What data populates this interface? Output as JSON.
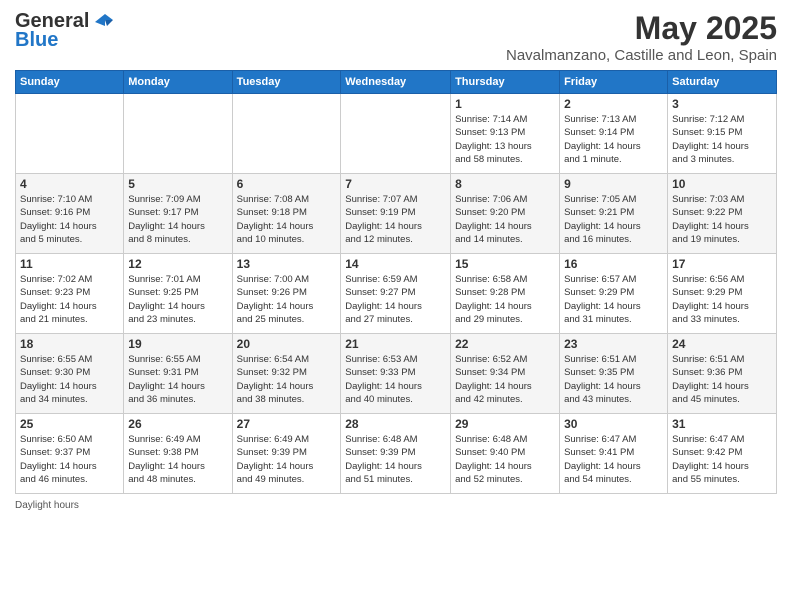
{
  "logo": {
    "general": "General",
    "blue": "Blue"
  },
  "header": {
    "title": "May 2025",
    "subtitle": "Navalmanzano, Castille and Leon, Spain"
  },
  "weekdays": [
    "Sunday",
    "Monday",
    "Tuesday",
    "Wednesday",
    "Thursday",
    "Friday",
    "Saturday"
  ],
  "weeks": [
    [
      {
        "day": "",
        "info": ""
      },
      {
        "day": "",
        "info": ""
      },
      {
        "day": "",
        "info": ""
      },
      {
        "day": "",
        "info": ""
      },
      {
        "day": "1",
        "info": "Sunrise: 7:14 AM\nSunset: 9:13 PM\nDaylight: 13 hours\nand 58 minutes."
      },
      {
        "day": "2",
        "info": "Sunrise: 7:13 AM\nSunset: 9:14 PM\nDaylight: 14 hours\nand 1 minute."
      },
      {
        "day": "3",
        "info": "Sunrise: 7:12 AM\nSunset: 9:15 PM\nDaylight: 14 hours\nand 3 minutes."
      }
    ],
    [
      {
        "day": "4",
        "info": "Sunrise: 7:10 AM\nSunset: 9:16 PM\nDaylight: 14 hours\nand 5 minutes."
      },
      {
        "day": "5",
        "info": "Sunrise: 7:09 AM\nSunset: 9:17 PM\nDaylight: 14 hours\nand 8 minutes."
      },
      {
        "day": "6",
        "info": "Sunrise: 7:08 AM\nSunset: 9:18 PM\nDaylight: 14 hours\nand 10 minutes."
      },
      {
        "day": "7",
        "info": "Sunrise: 7:07 AM\nSunset: 9:19 PM\nDaylight: 14 hours\nand 12 minutes."
      },
      {
        "day": "8",
        "info": "Sunrise: 7:06 AM\nSunset: 9:20 PM\nDaylight: 14 hours\nand 14 minutes."
      },
      {
        "day": "9",
        "info": "Sunrise: 7:05 AM\nSunset: 9:21 PM\nDaylight: 14 hours\nand 16 minutes."
      },
      {
        "day": "10",
        "info": "Sunrise: 7:03 AM\nSunset: 9:22 PM\nDaylight: 14 hours\nand 19 minutes."
      }
    ],
    [
      {
        "day": "11",
        "info": "Sunrise: 7:02 AM\nSunset: 9:23 PM\nDaylight: 14 hours\nand 21 minutes."
      },
      {
        "day": "12",
        "info": "Sunrise: 7:01 AM\nSunset: 9:25 PM\nDaylight: 14 hours\nand 23 minutes."
      },
      {
        "day": "13",
        "info": "Sunrise: 7:00 AM\nSunset: 9:26 PM\nDaylight: 14 hours\nand 25 minutes."
      },
      {
        "day": "14",
        "info": "Sunrise: 6:59 AM\nSunset: 9:27 PM\nDaylight: 14 hours\nand 27 minutes."
      },
      {
        "day": "15",
        "info": "Sunrise: 6:58 AM\nSunset: 9:28 PM\nDaylight: 14 hours\nand 29 minutes."
      },
      {
        "day": "16",
        "info": "Sunrise: 6:57 AM\nSunset: 9:29 PM\nDaylight: 14 hours\nand 31 minutes."
      },
      {
        "day": "17",
        "info": "Sunrise: 6:56 AM\nSunset: 9:29 PM\nDaylight: 14 hours\nand 33 minutes."
      }
    ],
    [
      {
        "day": "18",
        "info": "Sunrise: 6:55 AM\nSunset: 9:30 PM\nDaylight: 14 hours\nand 34 minutes."
      },
      {
        "day": "19",
        "info": "Sunrise: 6:55 AM\nSunset: 9:31 PM\nDaylight: 14 hours\nand 36 minutes."
      },
      {
        "day": "20",
        "info": "Sunrise: 6:54 AM\nSunset: 9:32 PM\nDaylight: 14 hours\nand 38 minutes."
      },
      {
        "day": "21",
        "info": "Sunrise: 6:53 AM\nSunset: 9:33 PM\nDaylight: 14 hours\nand 40 minutes."
      },
      {
        "day": "22",
        "info": "Sunrise: 6:52 AM\nSunset: 9:34 PM\nDaylight: 14 hours\nand 42 minutes."
      },
      {
        "day": "23",
        "info": "Sunrise: 6:51 AM\nSunset: 9:35 PM\nDaylight: 14 hours\nand 43 minutes."
      },
      {
        "day": "24",
        "info": "Sunrise: 6:51 AM\nSunset: 9:36 PM\nDaylight: 14 hours\nand 45 minutes."
      }
    ],
    [
      {
        "day": "25",
        "info": "Sunrise: 6:50 AM\nSunset: 9:37 PM\nDaylight: 14 hours\nand 46 minutes."
      },
      {
        "day": "26",
        "info": "Sunrise: 6:49 AM\nSunset: 9:38 PM\nDaylight: 14 hours\nand 48 minutes."
      },
      {
        "day": "27",
        "info": "Sunrise: 6:49 AM\nSunset: 9:39 PM\nDaylight: 14 hours\nand 49 minutes."
      },
      {
        "day": "28",
        "info": "Sunrise: 6:48 AM\nSunset: 9:39 PM\nDaylight: 14 hours\nand 51 minutes."
      },
      {
        "day": "29",
        "info": "Sunrise: 6:48 AM\nSunset: 9:40 PM\nDaylight: 14 hours\nand 52 minutes."
      },
      {
        "day": "30",
        "info": "Sunrise: 6:47 AM\nSunset: 9:41 PM\nDaylight: 14 hours\nand 54 minutes."
      },
      {
        "day": "31",
        "info": "Sunrise: 6:47 AM\nSunset: 9:42 PM\nDaylight: 14 hours\nand 55 minutes."
      }
    ]
  ],
  "legend": {
    "daylight_label": "Daylight hours"
  }
}
